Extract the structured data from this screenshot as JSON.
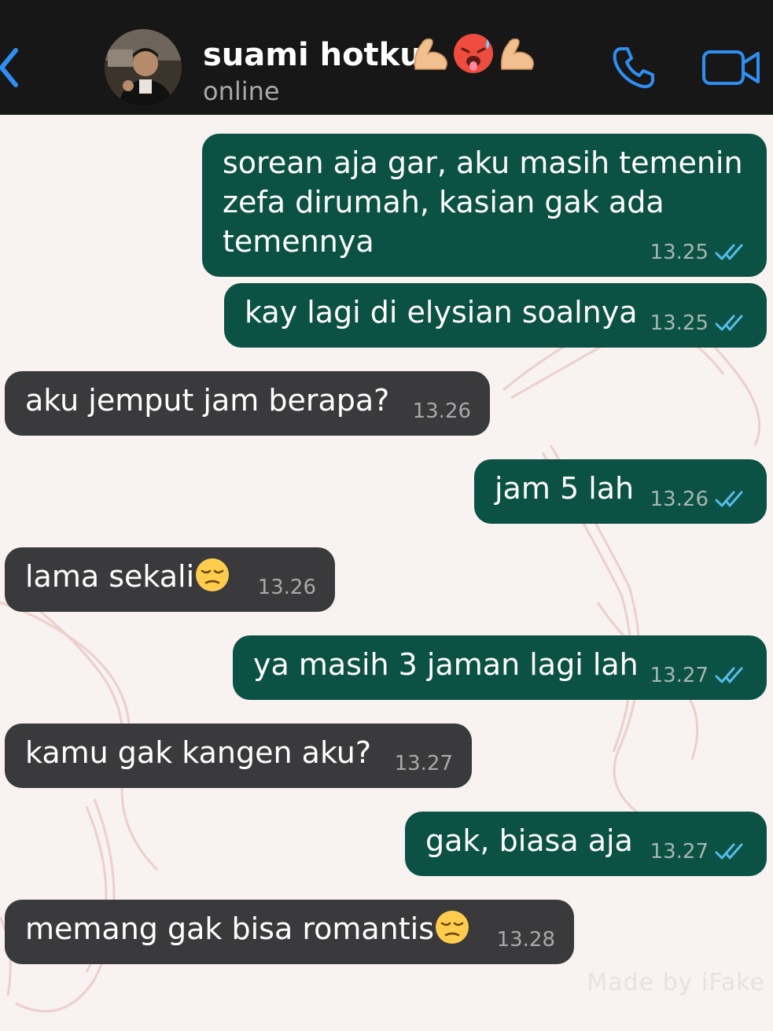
{
  "header": {
    "contact_name": "suami hotku",
    "status": "online",
    "name_emojis": [
      "flexed-biceps",
      "hot-face",
      "flexed-biceps"
    ]
  },
  "colors": {
    "header_bg": "#171717",
    "outgoing_bubble": "#0b5244",
    "incoming_bubble": "#3a3a3c",
    "accent_blue": "#2f8ef2",
    "read_tick": "#53bdeb",
    "wallpaper": "#f8f2f1"
  },
  "messages": [
    {
      "direction": "out",
      "text": "sorean aja gar, aku masih temenin zefa dirumah, kasian gak ada temennya",
      "time": "13.25",
      "status": "read"
    },
    {
      "direction": "out",
      "text": "kay lagi di elysian soalnya",
      "time": "13.25",
      "status": "read"
    },
    {
      "direction": "in",
      "text": "aku jemput jam berapa?",
      "time": "13.26"
    },
    {
      "direction": "out",
      "text": "jam 5 lah",
      "time": "13.26",
      "status": "read"
    },
    {
      "direction": "in",
      "text": "lama sekali",
      "emoji": "pensive-face",
      "time": "13.26"
    },
    {
      "direction": "out",
      "text": "ya masih 3 jaman lagi lah",
      "time": "13.27",
      "status": "read"
    },
    {
      "direction": "in",
      "text": "kamu gak kangen aku?",
      "time": "13.27"
    },
    {
      "direction": "out",
      "text": "gak, biasa aja",
      "time": "13.27",
      "status": "read"
    },
    {
      "direction": "in",
      "text": "memang gak bisa romantis",
      "emoji": "pensive-face",
      "time": "13.28"
    }
  ],
  "watermark": "Made by iFake"
}
